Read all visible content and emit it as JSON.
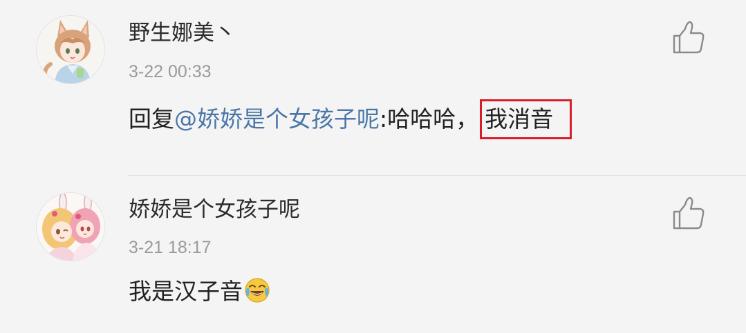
{
  "comments": [
    {
      "username": "野生娜美丶",
      "timestamp": "3-22 00:33",
      "reply_prefix": "回复",
      "mention": "@娇娇是个女孩子呢",
      "text_before_highlight": ":哈哈哈，",
      "highlighted_text": "我消音",
      "avatar_icon": "anime-girl-cat-ears-avatar",
      "like_icon": "thumbs-up-icon"
    },
    {
      "username": "娇娇是个女孩子呢",
      "timestamp": "3-21 18:17",
      "text": "我是汉子音",
      "emoji": "crying-laughing-emoji",
      "avatar_icon": "anime-girls-bunny-ears-avatar",
      "like_icon": "thumbs-up-icon"
    }
  ],
  "colors": {
    "background": "#f4f4f4",
    "mention": "#4a77a8",
    "highlight_border": "#d81e28",
    "timestamp": "#9a9a9a",
    "divider": "#e1e1e1"
  }
}
